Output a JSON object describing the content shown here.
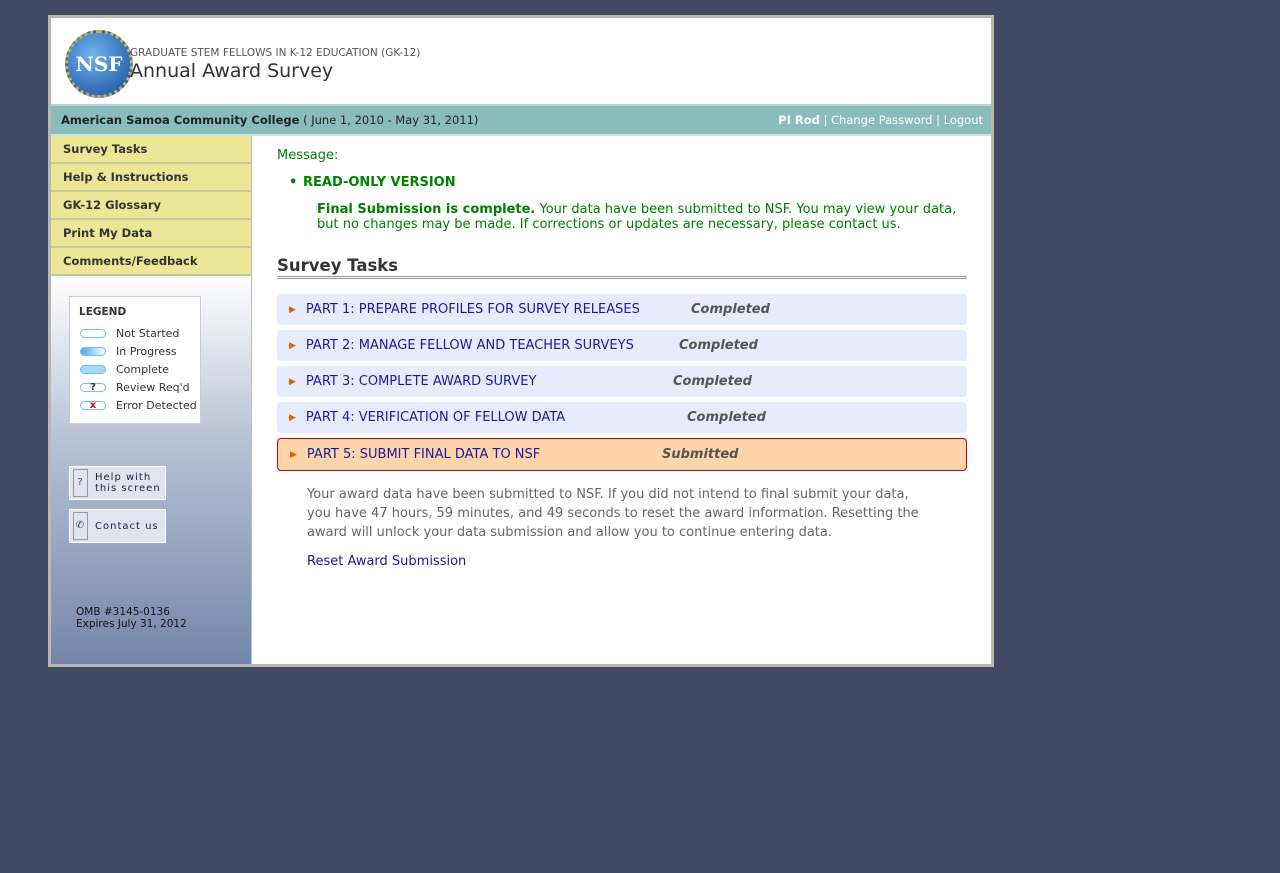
{
  "header": {
    "logo": "NSF",
    "subtitle": "GRADUATE STEM FELLOWS IN K-12 EDUCATION (GK-12)",
    "title": "Annual Award Survey"
  },
  "bar": {
    "institution": "American Samoa Community College",
    "period": "( June 1, 2010 - May 31, 2011)",
    "user": "PI Rod",
    "change_password": "Change Password",
    "logout": "Logout",
    "sep": "|"
  },
  "nav": [
    "Survey Tasks",
    "Help & Instructions",
    "GK-12 Glossary",
    "Print My Data",
    "Comments/Feedback"
  ],
  "legend": {
    "title": "LEGEND",
    "items": [
      "Not Started",
      "In Progress",
      "Complete",
      "Review Req'd",
      "Error Detected"
    ]
  },
  "help": {
    "help_line1": "Help with",
    "help_line2": "this screen",
    "contact": "Contact us"
  },
  "omb": {
    "number": "OMB #3145-0136",
    "expires": "Expires July 31, 2012"
  },
  "message": {
    "label": "Message:",
    "heading": "READ-ONLY VERSION",
    "bold": "Final Submission is complete.",
    "text": " Your data have been submitted to NSF. You may view your data, but no changes may be made. If corrections or updates are necessary, please contact us."
  },
  "section_title": "Survey Tasks",
  "tasks": [
    {
      "label": "PART 1: PREPARE PROFILES FOR SURVEY RELEASES",
      "status": "Completed"
    },
    {
      "label": "PART 2: MANAGE FELLOW AND TEACHER SURVEYS",
      "status": "Completed"
    },
    {
      "label": "PART 3: COMPLETE AWARD SURVEY",
      "status": "Completed"
    },
    {
      "label": "PART 4: VERIFICATION OF FELLOW DATA",
      "status": "Completed"
    },
    {
      "label": "PART 5: SUBMIT FINAL DATA TO NSF",
      "status": "Submitted"
    }
  ],
  "note": "Your award data have been submitted to NSF. If you did not intend to final submit your data, you have 47 hours, 59 minutes, and 49 seconds to reset the award information. Resetting the award will unlock your data submission and allow you to continue entering data.",
  "reset_link": "Reset Award Submission"
}
